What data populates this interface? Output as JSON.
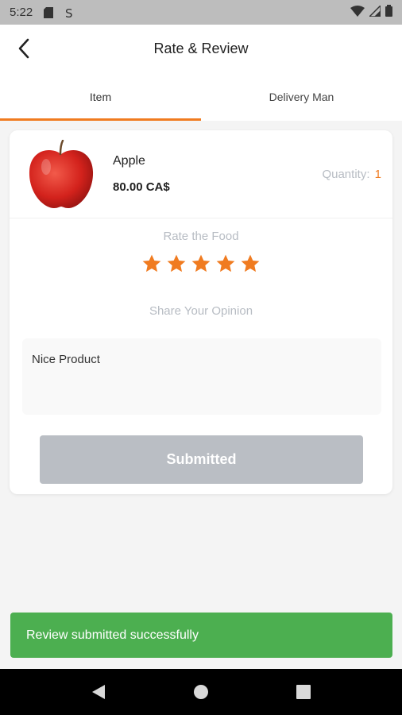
{
  "status_bar": {
    "time": "5:22",
    "icons": [
      "sd-card-icon",
      "sync-icon",
      "wifi-icon",
      "signal-icon",
      "battery-icon"
    ]
  },
  "header": {
    "title": "Rate & Review",
    "back_icon": "back-arrow-icon"
  },
  "tabs": [
    {
      "label": "Item",
      "active": true
    },
    {
      "label": "Delivery Man",
      "active": false
    }
  ],
  "product": {
    "name": "Apple",
    "price": "80.00 CA$",
    "quantity_label": "Quantity:",
    "quantity_value": "1",
    "image_icon": "apple-image"
  },
  "rating": {
    "label": "Rate the Food",
    "value": 5,
    "max": 5
  },
  "opinion": {
    "label": "Share Your Opinion",
    "text": "Nice Product"
  },
  "submit_label": "Submitted",
  "snackbar": {
    "message": "Review submitted successfully"
  },
  "nav": [
    "back-triangle-icon",
    "home-circle-icon",
    "recents-square-icon"
  ],
  "colors": {
    "accent": "#f07b20",
    "success": "#4caf50",
    "disabled": "#babec4",
    "muted_text": "#b7bcc3"
  }
}
